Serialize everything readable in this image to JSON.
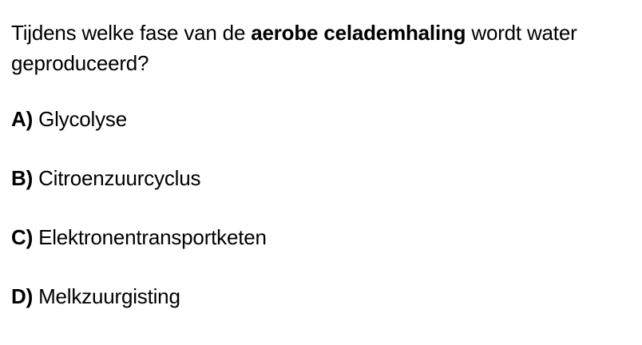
{
  "question": {
    "before": "Tijdens welke fase van de ",
    "emphasis": "aerobe celademhaling",
    "after": " wordt water geproduceerd?"
  },
  "options": [
    {
      "letter": "A)",
      "text": " Glycolyse"
    },
    {
      "letter": "B)",
      "text": " Citroenzuurcyclus"
    },
    {
      "letter": "C)",
      "text": " Elektronentransportketen"
    },
    {
      "letter": "D)",
      "text": " Melkzuurgisting"
    }
  ]
}
